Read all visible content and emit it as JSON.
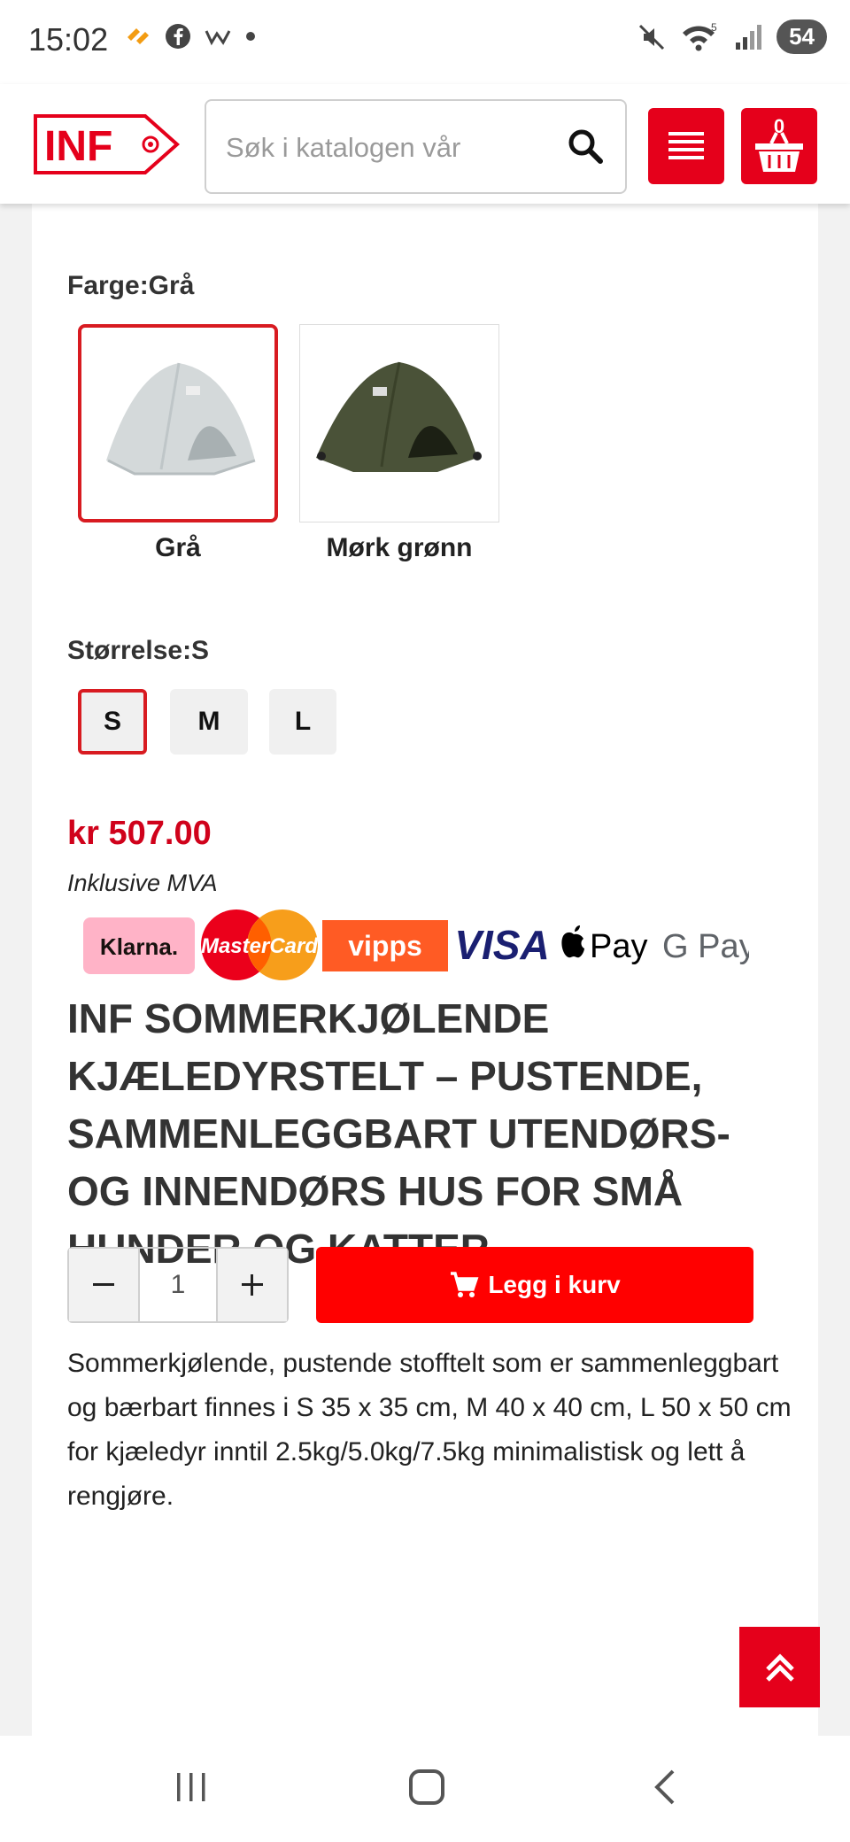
{
  "status_bar": {
    "time": "15:02",
    "left_icons": [
      "stylus-icon",
      "facebook-icon",
      "w-icon",
      "dot-icon"
    ],
    "right_icons": [
      "mute-icon",
      "wifi-icon",
      "signal-icon"
    ],
    "wifi_badge": "5",
    "battery": "54"
  },
  "header": {
    "logo_text": "INF",
    "search_placeholder": "Søk i katalogen vår",
    "cart_count": "0",
    "brand_color": "#e5001b"
  },
  "product": {
    "color_label": "Farge:Grå",
    "colors": [
      {
        "name": "Grå",
        "selected": true
      },
      {
        "name": "Mørk grønn",
        "selected": false
      }
    ],
    "size_label": "Størrelse:S",
    "sizes": [
      {
        "label": "S",
        "selected": true
      },
      {
        "label": "M",
        "selected": false
      },
      {
        "label": "L",
        "selected": false
      }
    ],
    "price": "kr 507.00",
    "vat_note": "Inklusive MVA",
    "payment_methods": [
      "Klarna.",
      "MasterCard",
      "vipps",
      "VISA",
      "Pay",
      "G Pay"
    ],
    "title": "INF SOMMERKJØLENDE KJÆLEDYRSTELT – PUSTENDE, SAMMENLEGGBART UTENDØRS- OG INNENDØRS HUS FOR SMÅ HUNDER OG KATTER",
    "quantity": "1",
    "add_to_cart": "Legg i kurv",
    "description": "Sommerkjølende, pustende stofftelt som er sammenleggbart og bærbart finnes i S 35 x 35 cm, M 40 x 40 cm, L 50 x 50 cm for kjæledyr inntil 2.5kg/5.0kg/7.5kg minimalistisk og lett å rengjøre."
  },
  "nav": [
    "recent-apps-icon",
    "home-icon",
    "back-icon"
  ]
}
